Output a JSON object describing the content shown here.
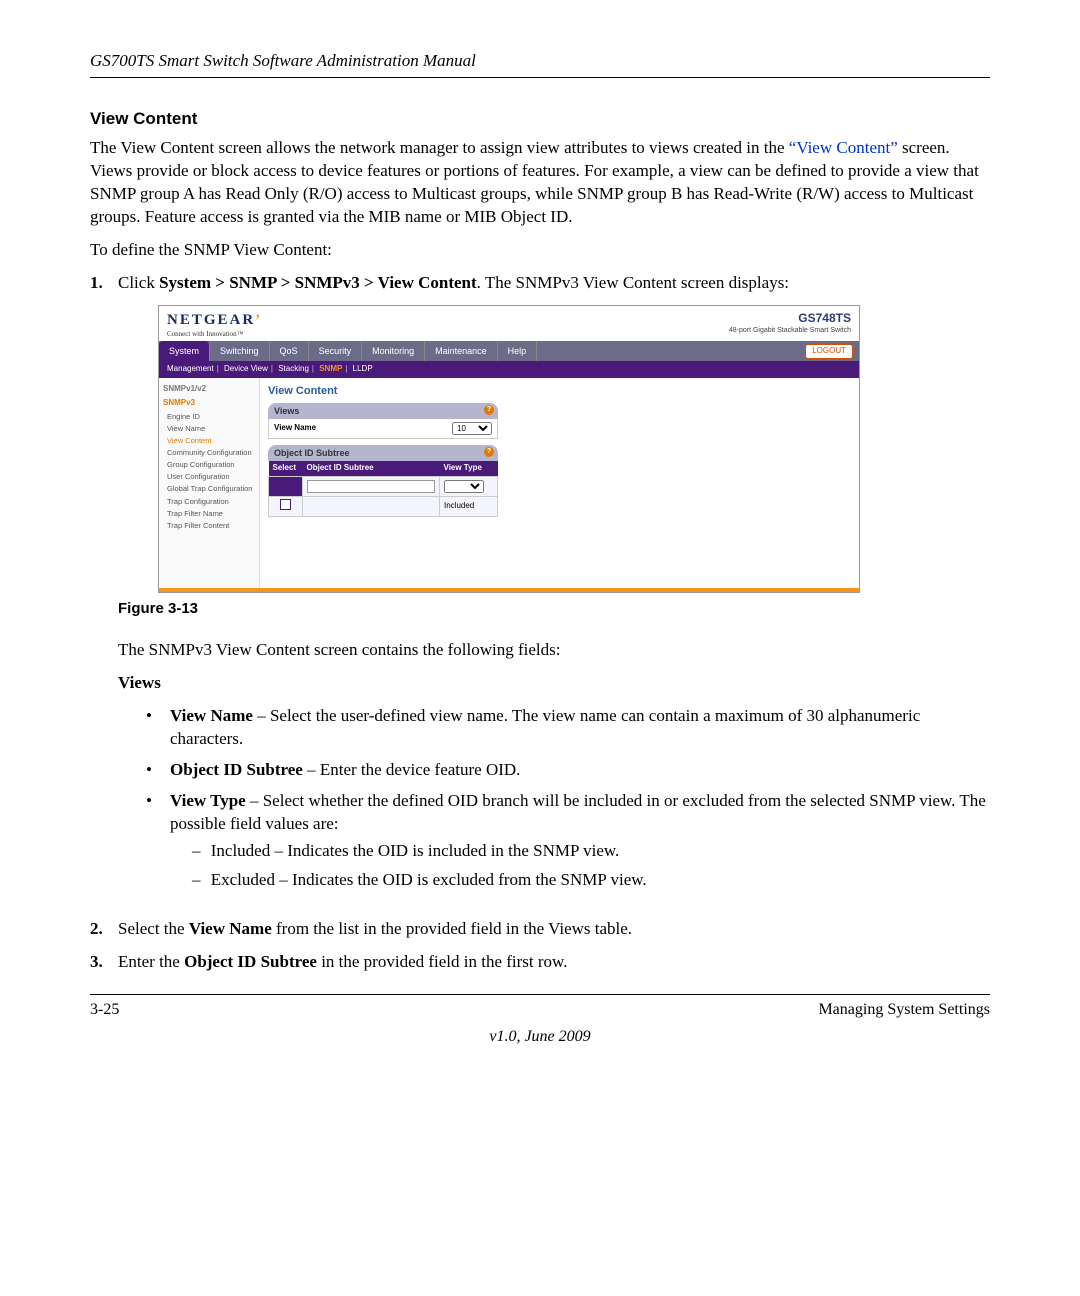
{
  "header": {
    "manual_title": "GS700TS Smart Switch Software Administration Manual"
  },
  "section": {
    "heading": "View Content",
    "para_pre": "The View Content screen allows the network manager to assign view attributes to views created in the ",
    "link_text": "“View Content”",
    "para_post": " screen. Views provide or block access to device features or portions of features. For example, a view can be defined to provide a view that SNMP group A has Read Only (R/O) access to Multicast groups, while SNMP group B has Read-Write (R/W) access to Multicast groups. Feature access is granted via the MIB name or MIB Object ID.",
    "para2": "To define the SNMP View Content:"
  },
  "steps": {
    "s1_num": "1.",
    "s1_pre": "Click ",
    "s1_bold": "System > SNMP > SNMPv3 > View Content",
    "s1_post": ". The SNMPv3 View Content screen displays:",
    "s2_num": "2.",
    "s2_pre": "Select the ",
    "s2_bold": "View Name",
    "s2_post": " from the list in the provided field in the Views table.",
    "s3_num": "3.",
    "s3_pre": "Enter the ",
    "s3_bold": "Object ID Subtree",
    "s3_post": " in the provided field in the first row."
  },
  "figure_caption": "Figure 3-13",
  "after_fig": "The SNMPv3 View Content screen contains the following fields:",
  "views_heading": "Views",
  "bullets": {
    "b1_bold": "View Name",
    "b1_text": " – Select the user-defined view name. The view name can contain a maximum of 30 alphanumeric characters.",
    "b2_bold": "Object ID Subtree",
    "b2_text": " – Enter the device feature OID.",
    "b3_bold": "View Type",
    "b3_text": " – Select whether the defined OID branch will be included in or excluded from the selected SNMP view. The possible field values are:",
    "d1": "Included – Indicates the OID is included in the SNMP view.",
    "d2": "Excluded – Indicates the OID is excluded from the SNMP view."
  },
  "footer": {
    "page": "3-25",
    "chapter": "Managing System Settings",
    "version": "v1.0, June 2009"
  },
  "screenshot": {
    "brand": "NETGEAR",
    "brand_tag": "Connect with Innovation™",
    "model": "GS748TS",
    "model_sub": "48-port Gigabit Stackable Smart Switch",
    "tabs": [
      "System",
      "Switching",
      "QoS",
      "Security",
      "Monitoring",
      "Maintenance",
      "Help"
    ],
    "logout": "LOGOUT",
    "subtabs": [
      "Management",
      "Device View",
      "Stacking",
      "SNMP",
      "LLDP"
    ],
    "sidebar_hdr1": "SNMPv1/v2",
    "sidebar_hdr2": "SNMPv3",
    "sidebar_items": [
      "Engine ID",
      "View Name",
      "View Content",
      "Community Configuration",
      "Group Configuration",
      "User Configuration",
      "Global Trap Configuration",
      "Trap Configuration",
      "Trap Filter Name",
      "Trap Filter Content"
    ],
    "content_title": "View Content",
    "panel1_title": "Views",
    "view_name_label": "View Name",
    "view_name_option": "10",
    "panel2_title": "Object ID Subtree",
    "th_select": "Select",
    "th_oid": "Object ID Subtree",
    "th_vtype": "View Type",
    "row2_vtype": "Included"
  }
}
